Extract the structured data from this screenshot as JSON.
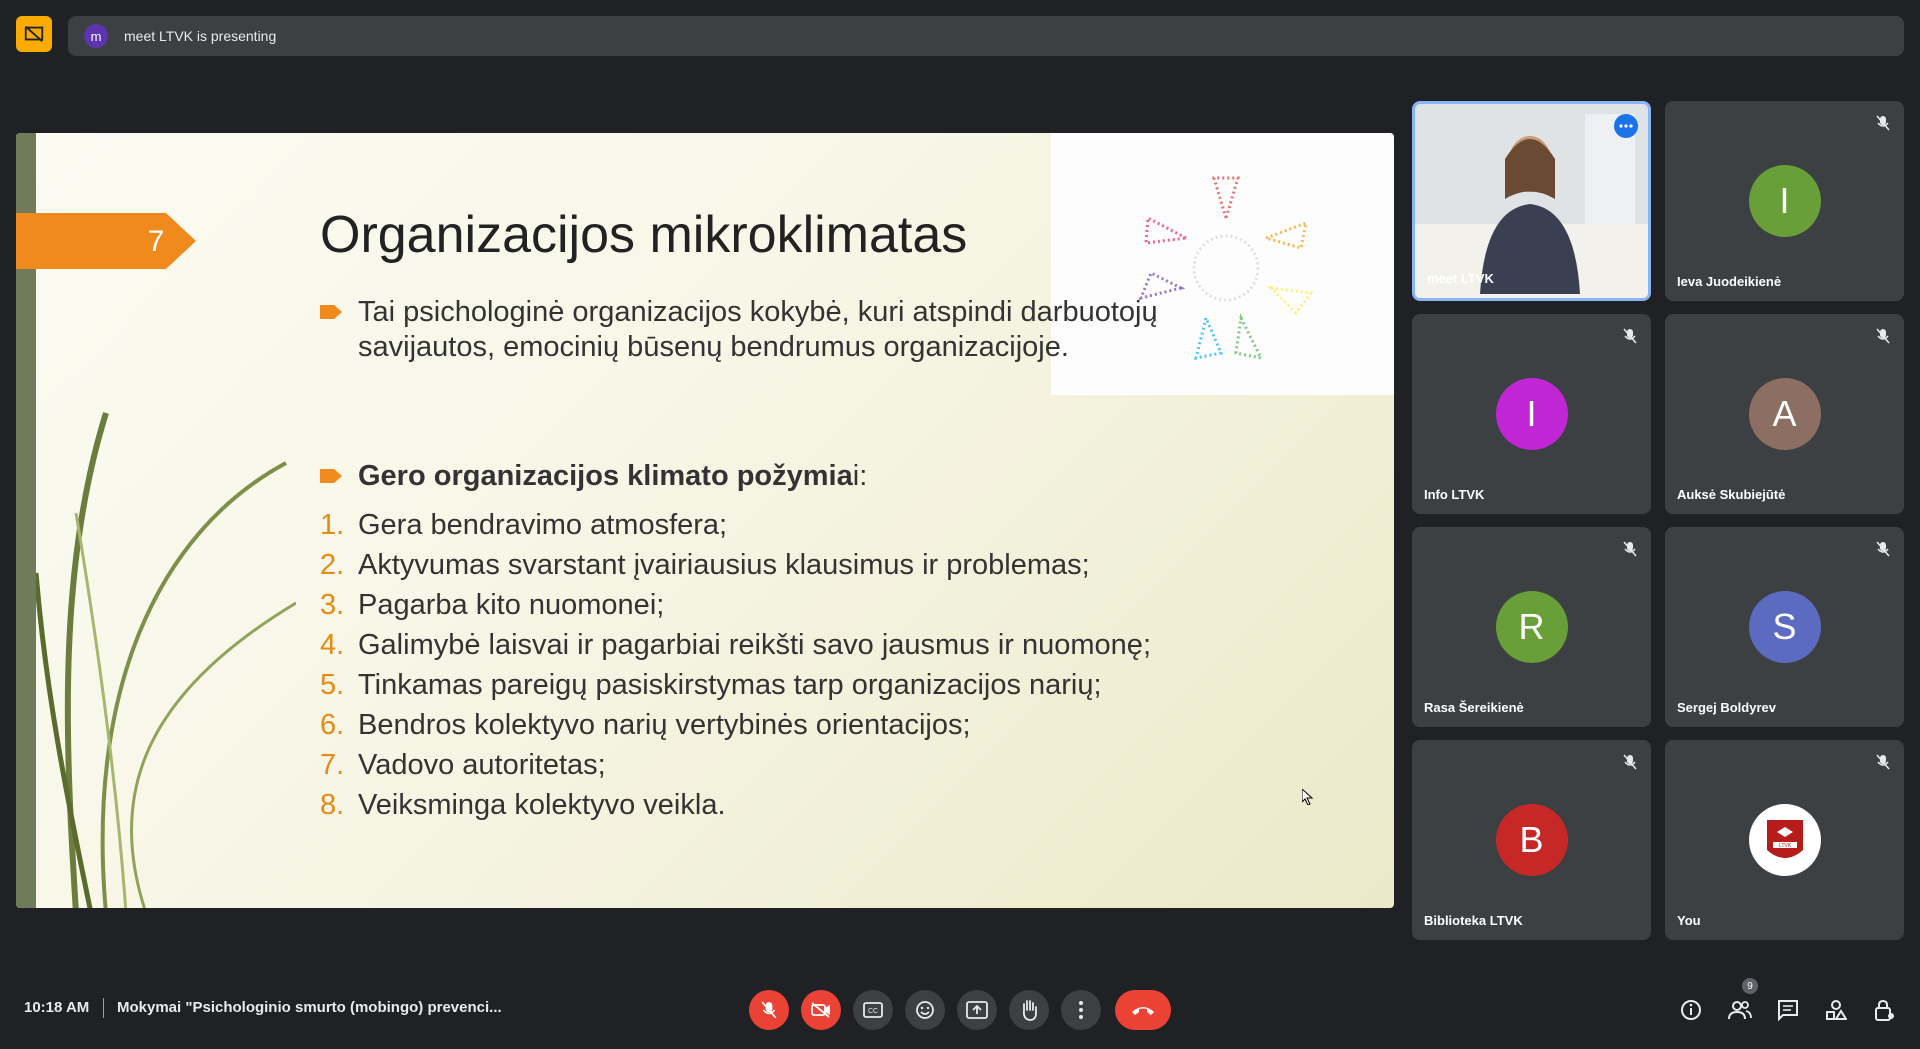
{
  "presenter_bar": {
    "avatar_letter": "m",
    "text": "meet LTVK is presenting"
  },
  "slide": {
    "number": "7",
    "title": "Organizacijos mikroklimatas",
    "bullet1": "Tai psichologinė organizacijos kokybė, kuri atspindi darbuotojų savijautos, emocinių būsenų bendrumus organizacijoje.",
    "bullet2_bold": "Gero organizacijos klimato požymia",
    "bullet2_rest": "i:",
    "items": [
      {
        "n": "1.",
        "text": "Gera bendravimo atmosfera;"
      },
      {
        "n": "2.",
        "text": "Aktyvumas svarstant įvairiausius klausimus ir problemas;"
      },
      {
        "n": "3.",
        "text": "Pagarba kito nuomonei;"
      },
      {
        "n": "4.",
        "text": "Galimybė laisvai ir pagarbiai reikšti savo jausmus ir nuomonę;"
      },
      {
        "n": "5.",
        "text": "Tinkamas pareigų pasiskirstymas tarp organizacijos narių;"
      },
      {
        "n": "6.",
        "text": "Bendros kolektyvo narių vertybinės orientacijos;"
      },
      {
        "n": "7.",
        "text": "Vadovo autoritetas;"
      },
      {
        "n": "8.",
        "text": "Veiksminga kolektyvo veikla."
      }
    ],
    "accent_color": "#e58a12"
  },
  "participants": [
    {
      "name": "meet LTVK",
      "type": "video"
    },
    {
      "name": "Ieva Juodeikienė",
      "letter": "I",
      "color": "#689f38"
    },
    {
      "name": "Info LTVK",
      "letter": "I",
      "color": "#c026d3"
    },
    {
      "name": "Auksė Skubiejūtė",
      "letter": "A",
      "color": "#8d6e63"
    },
    {
      "name": "Rasa Šereikienė",
      "letter": "R",
      "color": "#689f38"
    },
    {
      "name": "Sergej Boldyrev",
      "letter": "S",
      "color": "#5c6bc0"
    },
    {
      "name": "Biblioteka LTVK",
      "letter": "B",
      "color": "#c62828"
    },
    {
      "name": "You",
      "logo": "LTVK"
    }
  ],
  "bottom": {
    "time": "10:18 AM",
    "meeting_title": "Mokymai \"Psichologinio smurto (mobingo) prevenci...",
    "participant_count": "9"
  },
  "icons": {
    "mic_off": "mic-off-icon",
    "cam_off": "camera-off-icon",
    "captions": "captions-icon",
    "emoji": "emoji-icon",
    "present": "present-icon",
    "hand": "raise-hand-icon",
    "more": "more-vert-icon",
    "end": "end-call-icon",
    "info": "info-icon",
    "people": "people-icon",
    "chat": "chat-icon",
    "activities": "activities-icon",
    "lock": "host-controls-icon"
  }
}
